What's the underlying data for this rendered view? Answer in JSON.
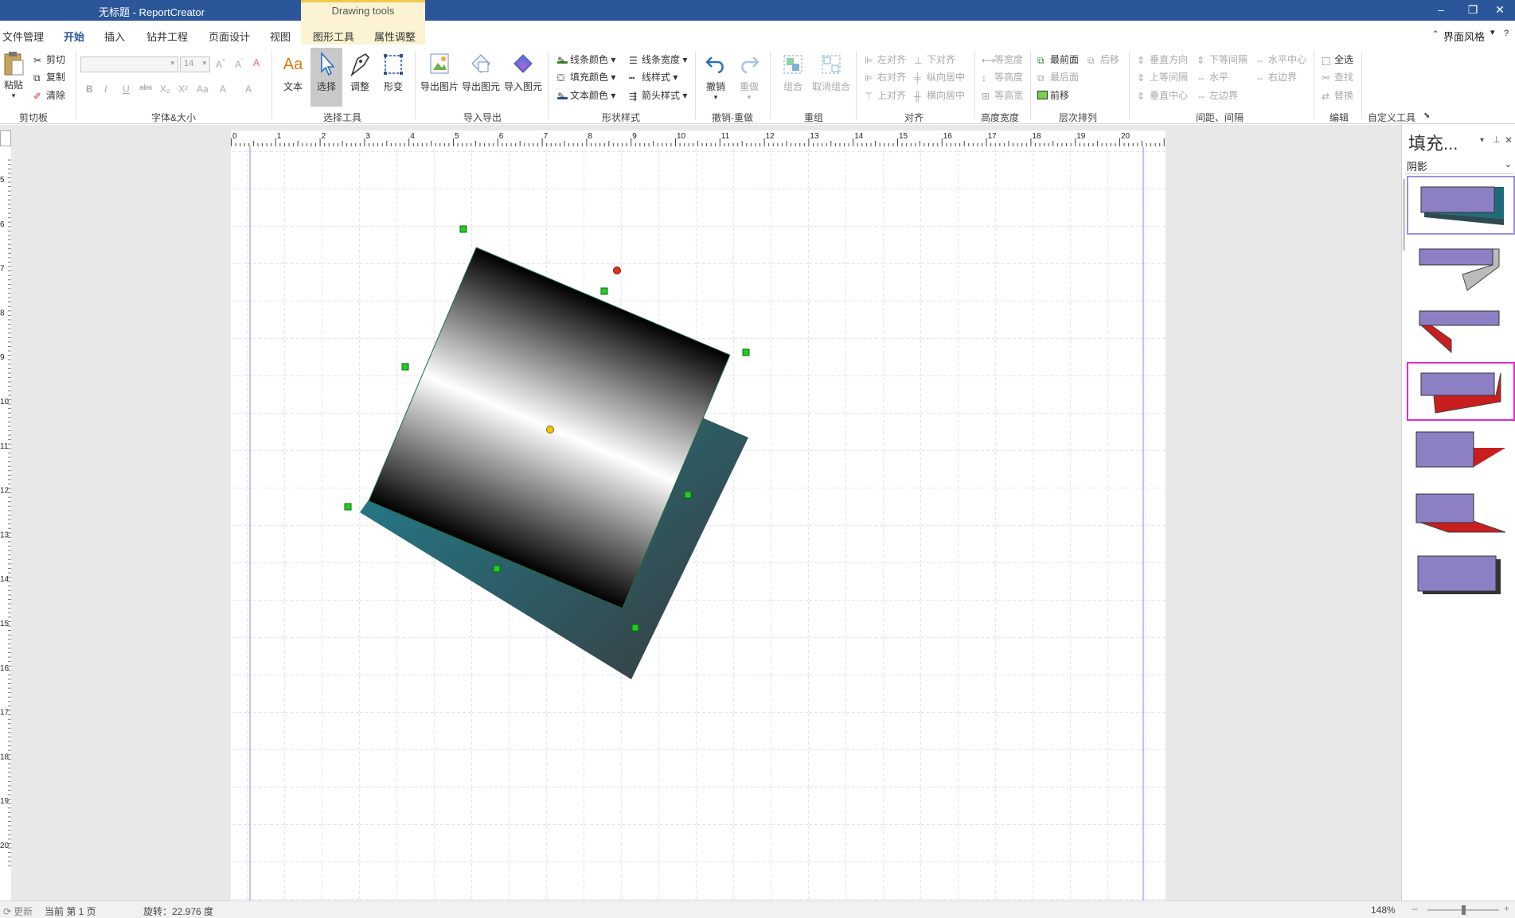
{
  "window": {
    "title": "无标题 - ReportCreator",
    "contextual_tab": "Drawing tools",
    "controls": {
      "minimize": "–",
      "restore": "❐",
      "close": "✕"
    }
  },
  "menu": {
    "tabs": [
      "文件管理",
      "开始",
      "插入",
      "钻井工程",
      "页面设计",
      "视图",
      "图形工具",
      "属性调整"
    ],
    "active_tab": "开始",
    "ui_style": "界面风格"
  },
  "ribbon": {
    "clipboard": {
      "paste": "粘贴",
      "cut": "剪切",
      "copy": "复制",
      "clear": "清除",
      "label": "剪切板"
    },
    "font": {
      "size": "14",
      "label": "字体&大小",
      "buttons": [
        "B",
        "I",
        "U",
        "abc",
        "X₂",
        "X²",
        "Aa",
        "A",
        "A"
      ]
    },
    "select_tools": {
      "text": "文本",
      "select": "选择",
      "adjust": "调整",
      "transform": "形变",
      "label": "选择工具"
    },
    "import_export": {
      "export_image": "导出图片",
      "export_element": "导出图元",
      "import_element": "导入图元",
      "label": "导入导出"
    },
    "shape_style": {
      "line_color": "线条颜色",
      "fill_color": "填充颜色",
      "text_color": "文本颜色",
      "line_width": "线条宽度",
      "line_style": "线样式",
      "arrow_style": "箭头样式",
      "label": "形状样式"
    },
    "undo_redo": {
      "undo": "撤销",
      "redo": "重做",
      "label": "撤销-重做"
    },
    "group": {
      "group": "组合",
      "ungroup": "取消组合",
      "label": "重组"
    },
    "align": {
      "left": "左对齐",
      "right": "右对齐",
      "top": "上对齐",
      "bottom": "下对齐",
      "vcenter": "纵向居中",
      "hcenter": "横向居中",
      "label": "对齐"
    },
    "size": {
      "same_width": "等宽度",
      "same_height": "等高度",
      "same_size": "等高宽",
      "label": "高度宽度"
    },
    "order": {
      "front": "最前面",
      "back": "最后面",
      "forward": "前移",
      "backward": "后移",
      "label": "层次排列"
    },
    "spacing": {
      "v_dir": "垂直方向",
      "v_equal": "上等间隔",
      "v_center": "垂直中心",
      "h_equal": "下等间隔",
      "horizontal": "水平",
      "left_border": "左边界",
      "h_center": "水平中心",
      "right_border": "右边界",
      "label": "间距、间隔"
    },
    "edit": {
      "select_all": "全选",
      "find": "查找",
      "replace": "替换",
      "label": "编辑"
    },
    "custom": {
      "label": "自定义工具"
    }
  },
  "ruler": {
    "h_numbers": [
      "0",
      "1",
      "2",
      "3",
      "4",
      "5",
      "6",
      "7",
      "8",
      "9",
      "10",
      "11",
      "12",
      "13",
      "14",
      "15",
      "16",
      "17",
      "18",
      "19",
      "20"
    ],
    "v_numbers": [
      "5",
      "6",
      "7",
      "8",
      "9",
      "10",
      "11",
      "12",
      "13",
      "14",
      "15",
      "16",
      "17",
      "18",
      "19",
      "20"
    ]
  },
  "panel": {
    "title": "填充...",
    "dropdown": "阴影",
    "swatch_count": 7
  },
  "canvas": {
    "rotation_deg": 22.976,
    "gradient": "black-white-black",
    "shadow_color_start": "#1e8a9e",
    "shadow_color_end": "#3a3a3a"
  },
  "status": {
    "update": "更新",
    "page": "当前 第 1 页",
    "rotation": "旋转：22.976 度",
    "zoom": "148%"
  },
  "colors": {
    "titlebar": "#2b579a",
    "accent": "#2b579a",
    "handle": "#22cc22",
    "rotate_handle": "#e0301e",
    "center_handle": "#f2c40c",
    "swatch_fill": "#8c7fc4"
  }
}
